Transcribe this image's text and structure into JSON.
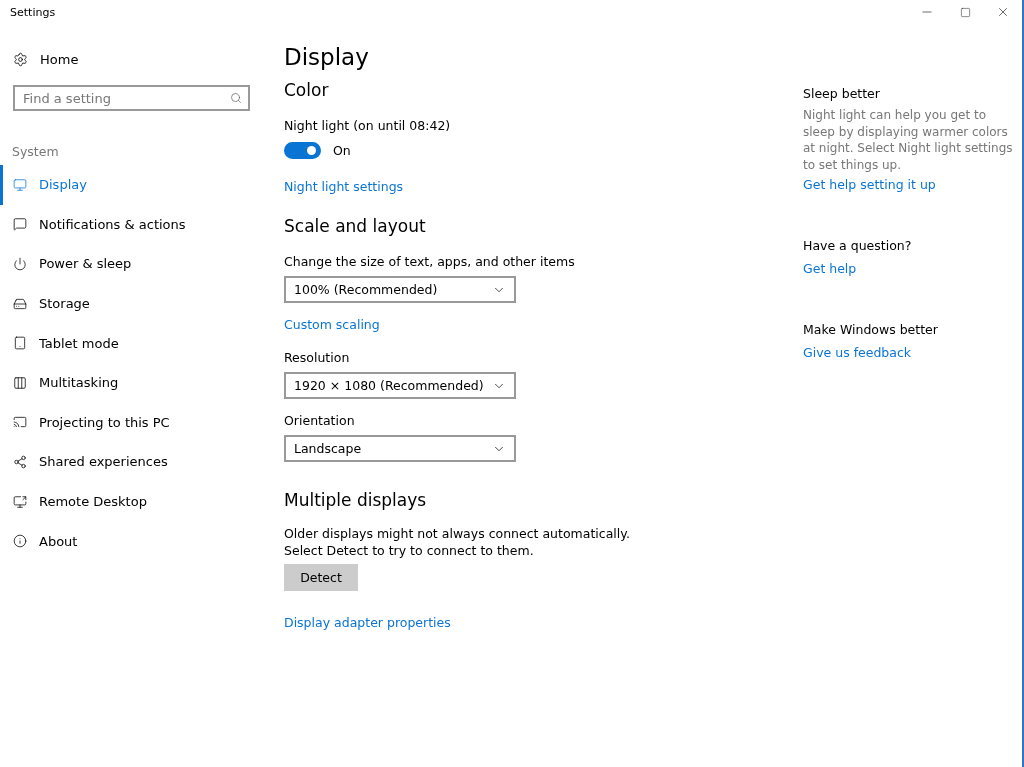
{
  "window": {
    "title": "Settings"
  },
  "sidebar": {
    "home": "Home",
    "search": {
      "placeholder": "Find a setting"
    },
    "group": "System",
    "items": [
      {
        "label": "Display",
        "selected": true
      },
      {
        "label": "Notifications & actions",
        "selected": false
      },
      {
        "label": "Power & sleep",
        "selected": false
      },
      {
        "label": "Storage",
        "selected": false
      },
      {
        "label": "Tablet mode",
        "selected": false
      },
      {
        "label": "Multitasking",
        "selected": false
      },
      {
        "label": "Projecting to this PC",
        "selected": false
      },
      {
        "label": "Shared experiences",
        "selected": false
      },
      {
        "label": "Remote Desktop",
        "selected": false
      },
      {
        "label": "About",
        "selected": false
      }
    ]
  },
  "main": {
    "title": "Display",
    "color": {
      "heading": "Color",
      "night_light_label": "Night light (on until 08:42)",
      "toggle": {
        "on": true,
        "label": "On"
      },
      "link": "Night light settings"
    },
    "scale": {
      "heading": "Scale and layout",
      "size_label": "Change the size of text, apps, and other items",
      "size_value": "100% (Recommended)",
      "link": "Custom scaling",
      "resolution_label": "Resolution",
      "resolution_value": "1920 × 1080 (Recommended)",
      "orientation_label": "Orientation",
      "orientation_value": "Landscape"
    },
    "multiple": {
      "heading": "Multiple displays",
      "text": "Older displays might not always connect automatically. Select Detect to try to connect to them.",
      "button": "Detect",
      "link": "Display adapter properties"
    }
  },
  "aside": [
    {
      "heading": "Sleep better",
      "text": "Night light can help you get to sleep by displaying warmer colors at night. Select Night light settings to set things up.",
      "link": "Get help setting it up"
    },
    {
      "heading": "Have a question?",
      "link": "Get help"
    },
    {
      "heading": "Make Windows better",
      "link": "Give us feedback"
    }
  ]
}
